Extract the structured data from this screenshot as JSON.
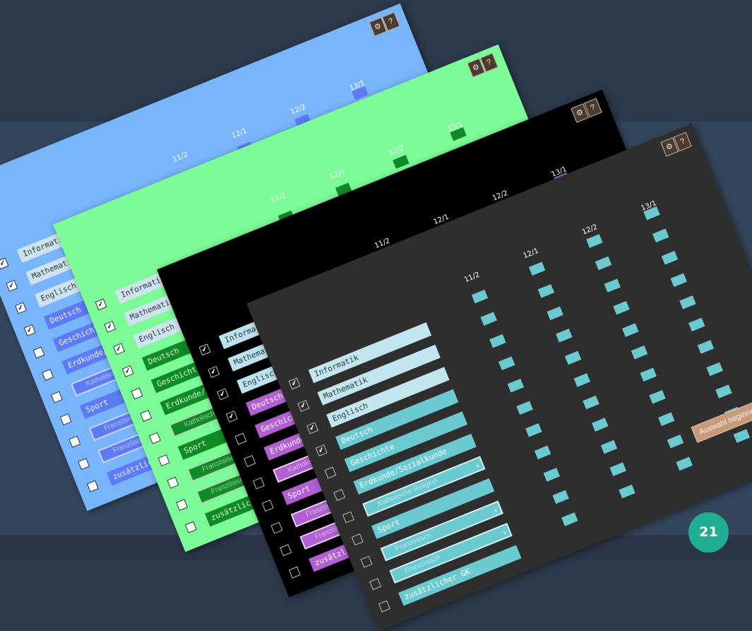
{
  "columns": [
    "11/2",
    "12/1",
    "12/2",
    "13/1"
  ],
  "subjects": [
    {
      "label": "Informatik",
      "checked": true,
      "type": "text"
    },
    {
      "label": "Mathematik",
      "checked": true,
      "type": "text"
    },
    {
      "label": "Englisch",
      "checked": true,
      "type": "text"
    },
    {
      "label": "Deutsch",
      "checked": true,
      "type": "text"
    },
    {
      "label": "Geschichte",
      "checked": false,
      "type": "text"
    },
    {
      "label": "Erdkunde/Sozialkunde",
      "checked": false,
      "type": "text"
    },
    {
      "label": "Katholische Religion",
      "checked": false,
      "type": "dropdown"
    },
    {
      "label": "Sport",
      "checked": false,
      "type": "text"
    },
    {
      "label": "Französisch",
      "checked": false,
      "type": "dropdown"
    },
    {
      "label": "Französisch",
      "checked": false,
      "type": "dropdown"
    },
    {
      "label": "zusätzlicher GK",
      "checked": false,
      "type": "text"
    }
  ],
  "windows": [
    {
      "theme": "blue"
    },
    {
      "theme": "green"
    },
    {
      "theme": "black"
    },
    {
      "theme": "dark",
      "start_button": "Auswahl beginnen"
    }
  ],
  "icons": {
    "settings": "gear-icon",
    "help": "help-icon",
    "help_glyph": "?",
    "settings_glyph": "⚙"
  },
  "check_glyph": "✔",
  "page_number": "21",
  "colors": {
    "blue": {
      "bg": "#78b5fb",
      "label": "#5d7cf3",
      "label_text": "#eef3ff",
      "top_label": "#cfe3ef",
      "sq": "#5d7cf3",
      "col_text": "#ffffff",
      "cb_border": "#1b2a55",
      "cb_bg": "#ffffff",
      "check": "#1b2a55"
    },
    "green": {
      "bg": "#7cfb98",
      "label": "#108a24",
      "label_text": "#dff7df",
      "top_label": "#cfe3ef",
      "sq": "#108a24",
      "col_text": "#ffffff",
      "cb_border": "#1b3a22",
      "cb_bg": "#ffffff",
      "check": "#1b3a22"
    },
    "black": {
      "bg": "#000000",
      "label": "#b15fd2",
      "label_text": "#ffffff",
      "top_label": "#bde2ef",
      "sq": "#b15fd2",
      "col_text": "#ffffff",
      "cb_border": "#bbbbbb",
      "cb_bg": "#000000",
      "check": "#ffffff"
    },
    "dark": {
      "bg": "#2e2e2e",
      "label": "#6bcad0",
      "label_text": "#ffffff",
      "top_label": "#c3e6ee",
      "sq": "#6bcad0",
      "col_text": "#ffffff",
      "cb_border": "#bbbbbb",
      "cb_bg": "#2e2e2e",
      "check": "#ffffff"
    }
  }
}
